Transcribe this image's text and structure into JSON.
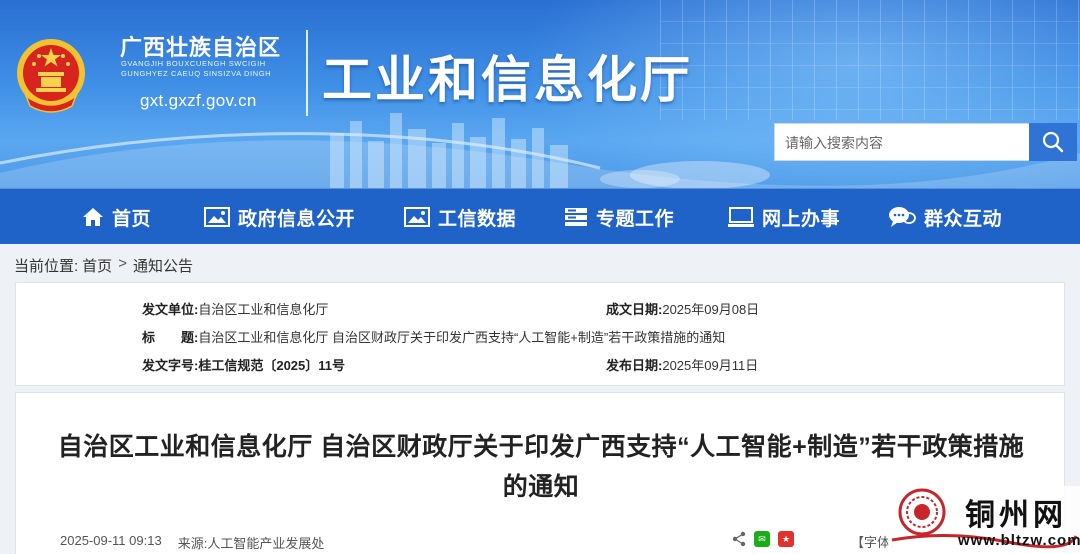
{
  "header": {
    "org_name_cn": "广西壮族自治区",
    "org_name_zhuang_line1": "GVANGJIH BOUXCUENGH SWCIGIH",
    "org_name_zhuang_line2": "GUNGHYEZ CAEUQ SINSIZVA DINGH",
    "site_url": "gxt.gxzf.gov.cn",
    "dept_title": "工业和信息化厅",
    "search_placeholder": "请输入搜索内容",
    "brand_color": "#1f62c8"
  },
  "nav": {
    "items": [
      {
        "label": "首页",
        "icon": "home-icon"
      },
      {
        "label": "政府信息公开",
        "icon": "picture-icon"
      },
      {
        "label": "工信数据",
        "icon": "picture-icon"
      },
      {
        "label": "专题工作",
        "icon": "stack-icon"
      },
      {
        "label": "网上办事",
        "icon": "monitor-icon"
      },
      {
        "label": "群众互动",
        "icon": "chat-icon"
      }
    ]
  },
  "breadcrumb": {
    "prefix": "当前位置:",
    "items": [
      "首页",
      "通知公告"
    ],
    "separator": ">"
  },
  "meta": {
    "issuer_label": "发文单位:",
    "issuer": "自治区工业和信息化厅",
    "date_written_label": "成文日期:",
    "date_written": "2025年09月08日",
    "title_label": "标　　题:",
    "title": "自治区工业和信息化厅 自治区财政厅关于印发广西支持“人工智能+制造”若干政策措施的通知",
    "doc_no_label": "发文字号:",
    "doc_no": "桂工信规范〔2025〕11号",
    "published_label": "发布日期:",
    "published": "2025年09月11日"
  },
  "article": {
    "title": "自治区工业和信息化厅 自治区财政厅关于印发广西支持“人工智能+制造”若干政策措施的通知",
    "datetime": "2025-09-11 09:13",
    "source_label": "来源:",
    "source": "人工智能产业发展处",
    "font_label": "【字体:"
  },
  "watermark": {
    "name": "铜州网",
    "url": "www.bltzw.com"
  }
}
